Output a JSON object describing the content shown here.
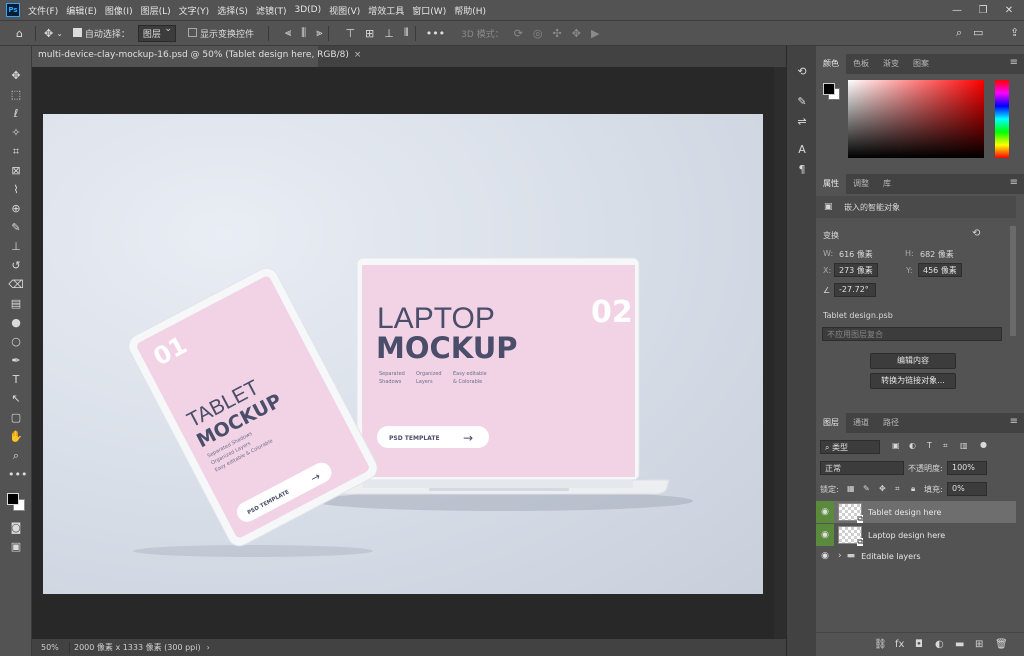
{
  "app": {
    "logo": "Ps",
    "menus": [
      "文件(F)",
      "编辑(E)",
      "图像(I)",
      "图层(L)",
      "文字(Y)",
      "选择(S)",
      "滤镜(T)",
      "3D(D)",
      "视图(V)",
      "增效工具",
      "窗口(W)",
      "帮助(H)"
    ],
    "window_controls": [
      "—",
      "❐",
      "✕"
    ]
  },
  "options": {
    "auto_select_label": "自动选择：",
    "auto_select_value": "图层",
    "show_transform_label": "显示变换控件",
    "mode_3d_label": "3D 模式：",
    "more": "•••"
  },
  "document": {
    "tab_title": "multi-device-clay-mockup-16.psd @ 50% (Tablet design here, RGB/8)",
    "zoom": "50%",
    "doc_info": "2000 像素 x 1333 像素 (300 ppi)"
  },
  "artwork": {
    "tablet": {
      "number": "01",
      "title_line1": "TABLET",
      "title_line2": "MOCKUP",
      "feature1": "Separated Shadows",
      "feature2": "Organized Layers",
      "feature3": "Easy editable & Colorable",
      "button": "PSD TEMPLATE"
    },
    "laptop": {
      "number": "02",
      "title_line1": "LAPTOP",
      "title_line2": "MOCKUP",
      "feature1a": "Separated",
      "feature1b": "Shadows",
      "feature2a": "Organized",
      "feature2b": "Layers",
      "feature3a": "Easy editable",
      "feature3b": "& Colorable",
      "button": "PSD TEMPLATE"
    }
  },
  "color_panel": {
    "tabs": [
      "颜色",
      "色板",
      "渐变",
      "图案"
    ]
  },
  "properties_panel": {
    "tabs": [
      "属性",
      "调整",
      "库"
    ],
    "kind": "嵌入的智能对象",
    "section": "变换",
    "w_label": "W:",
    "w_value": "616 像素",
    "h_label": "H:",
    "h_value": "682 像素",
    "x_label": "X:",
    "x_value": "273 像素",
    "y_label": "Y:",
    "y_value": "456 像素",
    "angle_value": "-27.72°",
    "source_file": "Tablet design.psb",
    "comp_placeholder": "不应用图层复合",
    "edit_button": "编辑内容",
    "convert_button": "转换为链接对象..."
  },
  "layers_panel": {
    "tabs": [
      "图层",
      "通道",
      "路径"
    ],
    "filter_kind": "类型",
    "blend_mode": "正常",
    "opacity_label": "不透明度:",
    "opacity_value": "100%",
    "lock_label": "锁定:",
    "fill_label": "填充:",
    "fill_value": "0%",
    "layers": [
      {
        "name": "Tablet design here",
        "selected": true
      },
      {
        "name": "Laptop design here",
        "selected": false
      },
      {
        "name": "Editable layers",
        "selected": false
      }
    ]
  },
  "colors": {
    "accent_green": "#5a8a3c",
    "screen_pink": "#f1cfe2",
    "title_dark": "#4a4e6a",
    "foreground": "#000000",
    "background": "#ffffff"
  }
}
